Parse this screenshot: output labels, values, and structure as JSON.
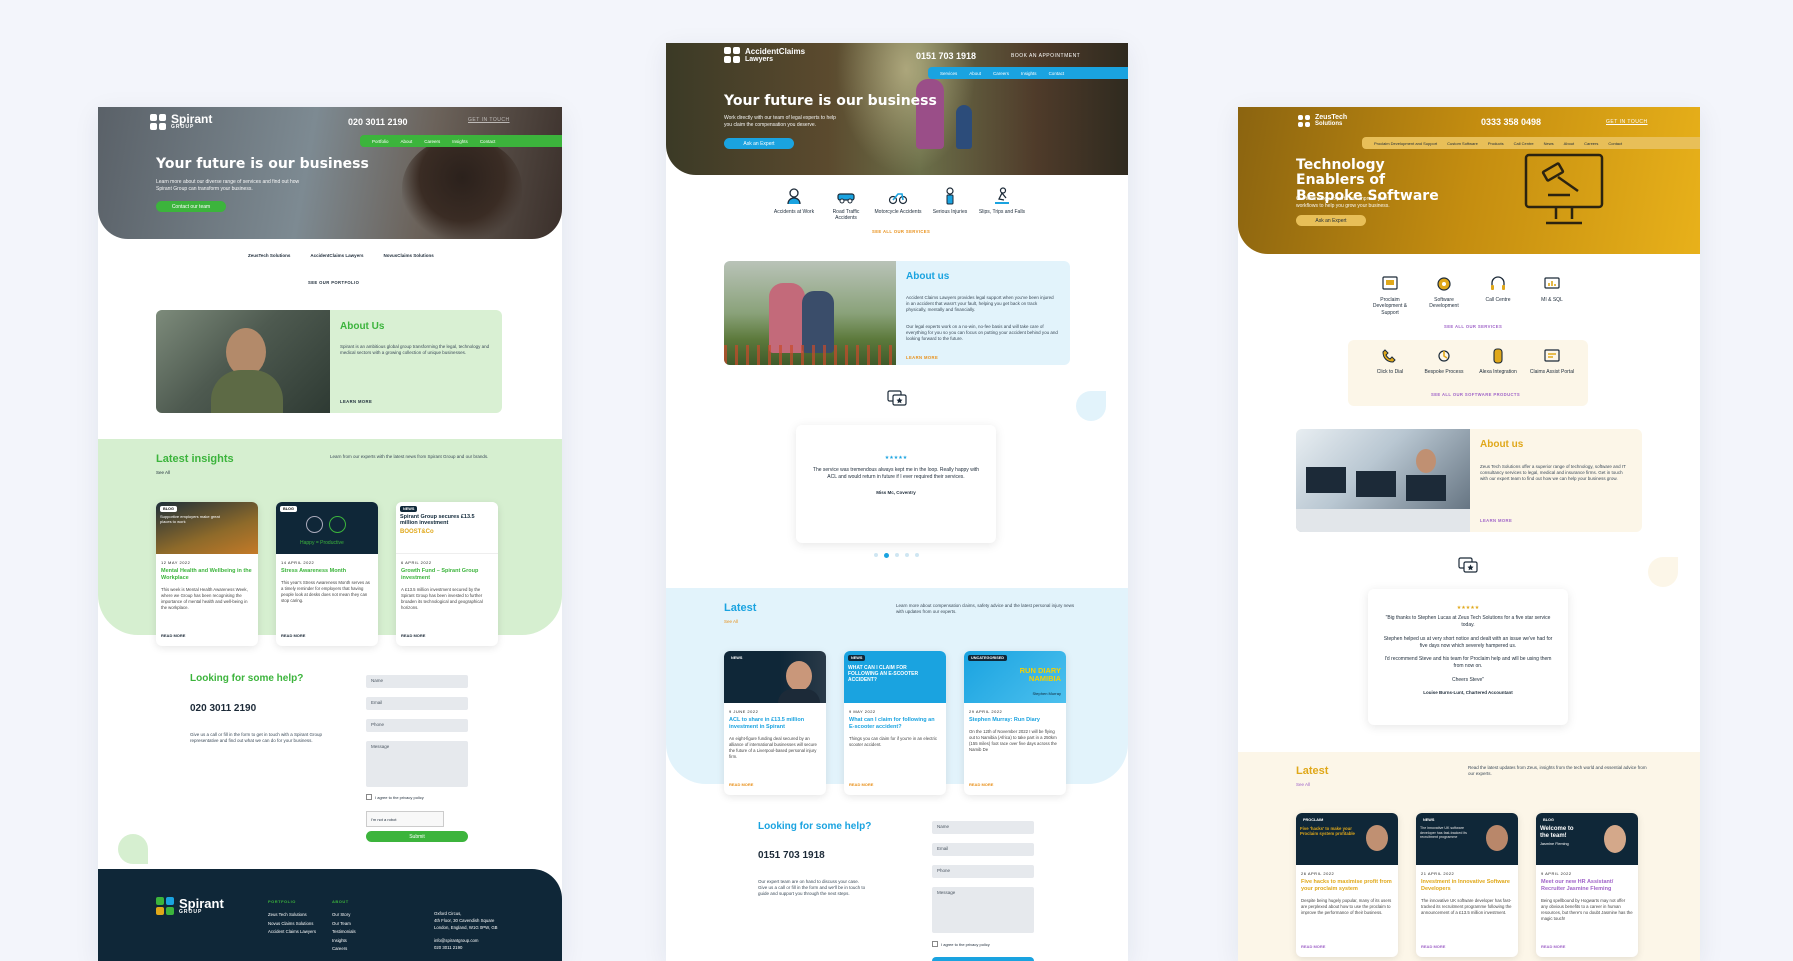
{
  "mock1": {
    "logo_name": "Spirant",
    "logo_sub": "GROUP",
    "phone": "020 3011 2190",
    "top_link": "GET IN TOUCH",
    "nav": [
      "Portfolio",
      "About",
      "Careers",
      "Insights",
      "Contact"
    ],
    "hero_title": "Your future is our business",
    "hero_sub": "Learn more about our diverse range of services and find out how Spirant Group can transform your business.",
    "hero_cta": "Contact our team",
    "partners": [
      "ZeusTech Solutions",
      "AccidentClaims Lawyers",
      "NovusClaims Solutions"
    ],
    "partners_link": "SEE OUR PORTFOLIO",
    "about_title": "About Us",
    "about_text": "Spirant is an ambitious global group transforming the legal, technology and medical sectors with a growing collection of unique businesses.",
    "about_link": "LEARN MORE",
    "insights_title": "Latest insights",
    "insights_see_all": "See All",
    "insights_desc": "Learn from our experts with the latest news from Spirant Group and our brands.",
    "cards": [
      {
        "badge": "BLOG",
        "img_text": "Supportive employers make great places to work",
        "date": "12 MAY 2022",
        "title": "Mental Health and Wellbeing in the Workplace",
        "body": "This week is Mental Health Awareness Week, where we Group has been recognising the importance of mental health and well-being in the workplace.",
        "read": "READ MORE"
      },
      {
        "badge": "BLOG",
        "img_text": "Happy = Productive",
        "date": "14 APRIL 2022",
        "title": "Stress Awareness Month",
        "body": "This year's Stress Awareness Month serves as a timely reminder for employers that having people look at desks does not mean they can stop caring.",
        "read": "READ MORE"
      },
      {
        "badge": "NEWS",
        "img_text": "Spirant Group secures £13.5 million investment",
        "img_brand": "BOOST&Co",
        "date": "6 APRIL 2022",
        "title": "Growth Fund – Spirant Group investment",
        "body": "A £13.5 million investment secured by the Spirant Group has been invested to further broaden its technological and geographical horizons.",
        "read": "READ MORE"
      }
    ],
    "help_title": "Looking for some help?",
    "help_phone": "020 3011 2190",
    "help_text": "Give us a call or fill in the form to get in touch with a Spirant Group representative and find out what we can do for your business.",
    "form": {
      "name": "Name",
      "email": "Email",
      "phone": "Phone",
      "message": "Message",
      "privacy": "I agree to the privacy policy",
      "captcha": "I'm not a robot",
      "submit": "Submit"
    },
    "footer": {
      "col1_title": "PORTFOLIO",
      "col1": [
        "Zeus Tech Solutions",
        "Novus Claims Solutions",
        "Accident Claims Lawyers"
      ],
      "col2_title": "ABOUT",
      "col2": [
        "Our Story",
        "Our Team",
        "Testimonials",
        "Insights",
        "Careers"
      ],
      "address": [
        "Oxford Circus,",
        "4th Floor, 30 Cavendish Square",
        "London, England, W1G 0PW, GB",
        "",
        "info@spirantgroup.com",
        "020 3011 2190"
      ]
    }
  },
  "mock2": {
    "logo_name": "AccidentClaims",
    "logo_sub": "Lawyers",
    "phone": "0151 703 1918",
    "top_link": "BOOK AN APPOINTMENT",
    "nav": [
      "Services",
      "About",
      "Careers",
      "Insights",
      "Contact"
    ],
    "hero_title": "Your future is our business",
    "hero_sub": "Work directly with our team of legal experts to help you claim the compensation you deserve.",
    "hero_cta": "Ask an Expert",
    "services": [
      {
        "label": "Accidents at Work",
        "icon": "worker-icon"
      },
      {
        "label": "Road Traffic Accidents",
        "icon": "car-crash-icon"
      },
      {
        "label": "Motorcycle Accidents",
        "icon": "motorcycle-icon"
      },
      {
        "label": "Serious Injuries",
        "icon": "injury-icon"
      },
      {
        "label": "Slips, Trips and Falls",
        "icon": "slip-icon"
      }
    ],
    "services_link": "SEE ALL OUR SERVICES",
    "about_title": "About us",
    "about_text1": "Accident Claims Lawyers provides legal support when you've been injured in an accident that wasn't your fault, helping you get back on track physically, mentally and financially.",
    "about_text2": "Our legal experts work on a no-win, no-fee basis and will take care of everything for you so you can focus on putting your accident behind you and looking forward to the future.",
    "about_link": "LEARN MORE",
    "stars": "★★★★★",
    "testimonial": "The service was tremendous always kept me in the loop. Really happy with ACL and would return in future if I ever required their services.",
    "testimonial_author": "Miss Mc, Coventry",
    "latest_title": "Latest",
    "latest_see_all": "See All",
    "latest_desc": "Learn more about compensation claims, safety advice and the latest personal injury news with updates from our experts.",
    "cards": [
      {
        "badge": "NEWS",
        "img_text": "",
        "date": "9 JUNE 2022",
        "title": "ACL to share in £13.5 million investment in Spirant",
        "body": "An eight-figure funding deal secured by an alliance of international businesses will secure the future of a Liverpool-based personal injury firm.",
        "read": "READ MORE"
      },
      {
        "badge": "NEWS",
        "img_text": "WHAT CAN I CLAIM FOR FOLLOWING AN E-SCOOTER ACCIDENT?",
        "date": "9 MAY 2022",
        "title": "What can I claim for following an E-scooter accident?",
        "body": "Things you can claim for if you're in an electric scooter accident.",
        "read": "READ MORE"
      },
      {
        "badge": "UNCATEGORISED",
        "img_text": "RUN DIARY NAMIBIA",
        "img_sub": "Stephen Murray",
        "date": "29 APRIL 2022",
        "title": "Stephen Murray: Run Diary",
        "body": "On the 12th of November 2022 I will be flying out to Namibia (Africa) to take part in a 250km (155 miles) foot race over five days across the Namib De",
        "read": "READ MORE"
      }
    ],
    "help_title": "Looking for some help?",
    "help_phone": "0151 703 1918",
    "help_text": "Our expert team are on hand to discuss your case. Give us a call or fill in the form and we'll be in touch to guide and support you through the next steps.",
    "form": {
      "name": "Name",
      "email": "Email",
      "phone": "Phone",
      "message": "Message",
      "privacy": "I agree to the privacy policy"
    }
  },
  "mock3": {
    "logo_name": "ZeusTech",
    "logo_sub": "Solutions",
    "phone": "0333 358 0498",
    "top_link": "GET IN TOUCH",
    "nav": [
      "Proclaim Development and Support",
      "Custom Software",
      "Products",
      "Call Centre",
      "News",
      "About",
      "Careers",
      "Contact"
    ],
    "hero_title": "Technology Enablers of Bespoke Software",
    "hero_sub": "Our technology experts can improve your workflows to help you grow your business.",
    "hero_cta": "Ask an Expert",
    "services": [
      {
        "label": "Proclaim Development & Support",
        "icon": "proclaim-icon"
      },
      {
        "label": "Software Development",
        "icon": "software-icon"
      },
      {
        "label": "Call Centre",
        "icon": "headset-icon"
      },
      {
        "label": "MI & SQL",
        "icon": "database-icon"
      }
    ],
    "services_link": "SEE ALL OUR SERVICES",
    "products": [
      {
        "label": "Click to Dial",
        "icon": "dial-icon"
      },
      {
        "label": "Bespoke Process",
        "icon": "process-icon"
      },
      {
        "label": "Alexa Integration",
        "icon": "alexa-icon"
      },
      {
        "label": "Claims Assist Portal",
        "icon": "portal-icon"
      }
    ],
    "products_link": "SEE ALL OUR SOFTWARE PRODUCTS",
    "about_title": "About us",
    "about_text": "Zeus Tech Solutions offer a superior range of technology, software and IT consultancy services to legal, medical and insurance firms. Get in touch with our expert team to find out how we can help your business grow.",
    "about_link": "LEARN MORE",
    "stars": "★★★★★",
    "testimonial": [
      "\"Big thanks to Stephen Lucas at Zeus Tech Solutions for a five star service today.",
      "Stephen helped us at very short notice and dealt with an issue we've had for five days now which severely hampered us.",
      "I'd recommend Steve and his team for Proclaim help and will be using them from now on.",
      "Cheers Steve\""
    ],
    "testimonial_author": "Louise Burns-Lunt, Chartered Accountant",
    "latest_title": "Latest",
    "latest_see_all": "See All",
    "latest_desc": "Read the latest updates from Zeus, insights from the tech world and essential advice from our experts.",
    "cards": [
      {
        "badge": "PROCLAIM",
        "img_text": "Five 'hacks' to make your Proclaim system profitable",
        "date": "26 APRIL 2022",
        "title": "Five hacks to maximise profit from your proclaim system",
        "body": "Despite being hugely popular, many of its users are perplexed about how to use the proclaim to improve the performance of their business.",
        "read": "READ MORE"
      },
      {
        "badge": "NEWS",
        "img_text": "The innovative UK software developer has fast-tracked its recruitment programme",
        "date": "21 APRIL 2022",
        "title": "Investment in Innovative Software Developers",
        "body": "The innovative UK software developer has fast-tracked its recruitment programme following the announcement of a £13.5 million investment.",
        "read": "READ MORE"
      },
      {
        "badge": "BLOG",
        "img_text": "Welcome to the team!",
        "img_sub": "Jasmine Fleming",
        "date": "9 APRIL 2022",
        "title": "Meet our new HR Assistant/ Recruiter Jasmine Fleming",
        "body": "Being spellbound by Hogwarts may not offer any obvious benefits to a career in human resources, but there's no doubt Jasmine has the magic touch!",
        "read": "READ MORE"
      }
    ]
  },
  "colors": {
    "spirant_green": "#3cb43c",
    "spirant_navy": "#0f2738",
    "acl_blue": "#1aa3e0",
    "zeus_gold": "#e0a81a",
    "zeus_cream": "#fcf6e8"
  }
}
